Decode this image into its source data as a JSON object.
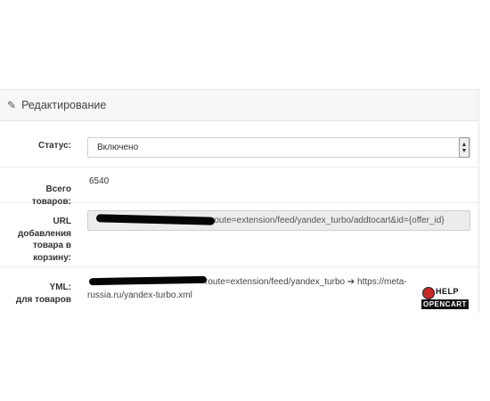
{
  "panel": {
    "title": "Редактирование",
    "icon": "pencil-icon"
  },
  "form": {
    "status": {
      "label": "Статус:",
      "value": "Включено"
    },
    "total": {
      "label": "Всего товаров:",
      "value": "6540"
    },
    "url": {
      "label": "URL добавления товара в корзину:",
      "value": "route=extension/feed/yandex_turbo/addtocart&id={offer_id}"
    },
    "yml": {
      "label": "YML:",
      "sublabel": "для товаров",
      "value_part1": "route=extension/feed/yandex_turbo",
      "value_part2": "https://meta-russia.ru/yandex-turbo.xml"
    }
  },
  "watermark": {
    "line1": "HELP",
    "line2": "OPENCART"
  },
  "colors": {
    "heading_bg": "#f7f7f7",
    "border": "#e6e6e6",
    "redaction": "#050505"
  }
}
